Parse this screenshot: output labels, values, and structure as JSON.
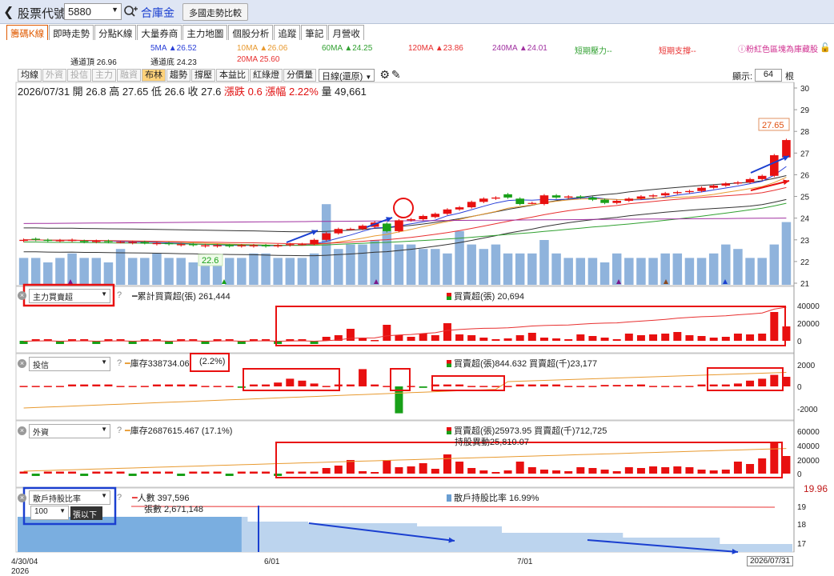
{
  "topbar": {
    "back_icon": "chevron-left-icon",
    "title": "股票代號",
    "code": "5880",
    "stock_name": "合庫金",
    "compare_button": "多國走勢比較"
  },
  "tabs": [
    "籌碼K線",
    "即時走勢",
    "分點K線",
    "大量券商",
    "主力地圖",
    "個股分析",
    "追蹤",
    "筆記",
    "月營收"
  ],
  "legend": {
    "ma5": "5MA ▲26.52",
    "ma10": "10MA ▲26.06",
    "ma60": "60MA ▲24.25",
    "ma120": "120MA ▲23.86",
    "ma240": "240MA ▲24.01",
    "short_pressure": "短期壓力--",
    "short_support": "短期支撐--",
    "channel_top": "通道頂 26.96",
    "channel_bottom": "通道底 24.23",
    "ma20": "20MA 25.60",
    "pink_note": "粉紅色區塊為庫藏股"
  },
  "toolbar": {
    "buttons": [
      "均線",
      "外資",
      "投信",
      "主力",
      "融資",
      "布林",
      "趨勢",
      "撐壓",
      "本益比",
      "紅綠燈",
      "分價量"
    ],
    "period": "日線(還原)",
    "show_label": "顯示:",
    "show_value": "64",
    "show_unit": "根"
  },
  "quote": {
    "text": "2026/07/31 開 26.8 高 27.65 低 26.6 收 27.6",
    "change": "漲跌 0.6 漲幅 2.22%",
    "volume": "量 49,661"
  },
  "panes": {
    "main_force": {
      "selector": "主力買賣超",
      "cum": "累計買賣超(張) 261,444",
      "buysell": "買賣超(張) 20,694"
    },
    "trust": {
      "selector": "投信",
      "inventory": "庫存338734.06",
      "pct": "(2.2%)",
      "buysell": "買賣超(張)844.632 買賣超(千)23,177"
    },
    "foreign": {
      "selector": "外資",
      "inventory": "庫存2687615.467 (17.1%)",
      "buysell": "買賣超(張)25973.95 買賣超(千)712,725",
      "holding_change": "持股異動25,810.07"
    },
    "holders": {
      "selector": "散戶持股比率",
      "threshold": "100",
      "threshold_unit": "張以下",
      "people": "人數 397,596",
      "shares": "張數 2,671,148",
      "ratio": "散戶持股比率 16.99%",
      "right_value": "19.96"
    }
  },
  "dates": {
    "start": "4/30/04",
    "year": "2026",
    "mid1": "6/01",
    "mid2": "7/01",
    "end": "2026/07/31"
  },
  "chart_data": [
    {
      "type": "candlestick",
      "title": "",
      "ylim": [
        21,
        30
      ],
      "y_ticks": [
        "30",
        "29",
        "28",
        "27",
        "26",
        "25",
        "24",
        "23",
        "22",
        "21"
      ],
      "last_close_label": "27.65",
      "low_label": "22.6",
      "close": [
        23.0,
        23.0,
        22.95,
        22.98,
        23.0,
        22.9,
        22.95,
        22.9,
        22.9,
        22.9,
        22.85,
        22.85,
        22.8,
        22.8,
        22.75,
        22.75,
        22.75,
        22.7,
        22.75,
        22.75,
        22.7,
        22.75,
        22.8,
        22.8,
        23.0,
        23.3,
        23.5,
        23.5,
        23.65,
        23.8,
        23.4,
        23.9,
        23.95,
        24.1,
        24.2,
        24.4,
        24.5,
        24.75,
        24.9,
        24.95,
        24.95,
        24.65,
        24.7,
        25.05,
        24.95,
        25.0,
        24.95,
        24.85,
        24.7,
        24.8,
        24.9,
        25.0,
        25.05,
        25.15,
        25.2,
        25.25,
        25.4,
        25.5,
        25.6,
        25.65,
        25.8,
        25.95,
        26.9,
        27.6
      ],
      "open": [
        22.95,
        23.05,
        23.0,
        22.95,
        22.95,
        22.95,
        22.9,
        22.95,
        22.9,
        22.85,
        22.9,
        22.8,
        22.85,
        22.75,
        22.8,
        22.7,
        22.7,
        22.75,
        22.7,
        22.7,
        22.75,
        22.7,
        22.75,
        22.8,
        22.8,
        23.0,
        23.3,
        23.5,
        23.5,
        23.6,
        23.75,
        23.4,
        23.9,
        23.95,
        24.05,
        24.2,
        24.4,
        24.5,
        24.75,
        24.9,
        25.1,
        24.9,
        24.7,
        24.65,
        25.05,
        24.95,
        25.0,
        24.95,
        24.85,
        24.7,
        24.8,
        24.9,
        25.0,
        25.05,
        25.15,
        25.2,
        25.25,
        25.4,
        25.5,
        25.6,
        25.65,
        25.8,
        25.95,
        26.8
      ],
      "volume_rel": [
        0.3,
        0.3,
        0.25,
        0.3,
        0.35,
        0.3,
        0.3,
        0.25,
        0.4,
        0.3,
        0.3,
        0.35,
        0.3,
        0.3,
        0.25,
        0.3,
        0.3,
        0.3,
        0.3,
        0.35,
        0.35,
        0.3,
        0.3,
        0.3,
        0.35,
        0.9,
        0.4,
        0.45,
        0.45,
        0.5,
        0.6,
        0.45,
        0.45,
        0.4,
        0.4,
        0.35,
        0.6,
        0.45,
        0.4,
        0.45,
        0.35,
        0.35,
        0.35,
        0.5,
        0.35,
        0.3,
        0.3,
        0.3,
        0.25,
        0.35,
        0.3,
        0.3,
        0.3,
        0.35,
        0.35,
        0.3,
        0.3,
        0.35,
        0.45,
        0.4,
        0.3,
        0.3,
        0.45,
        0.7
      ]
    }
  ],
  "colors": {
    "up": "#e81010",
    "down": "#18a018",
    "volume": "#8fb3dc",
    "ma5": "#2a40d8",
    "ma10": "#e89a30",
    "ma20": "#e83030",
    "ma60": "#30a030",
    "annotation_red": "#e81010",
    "annotation_blue": "#1a3fd0"
  }
}
